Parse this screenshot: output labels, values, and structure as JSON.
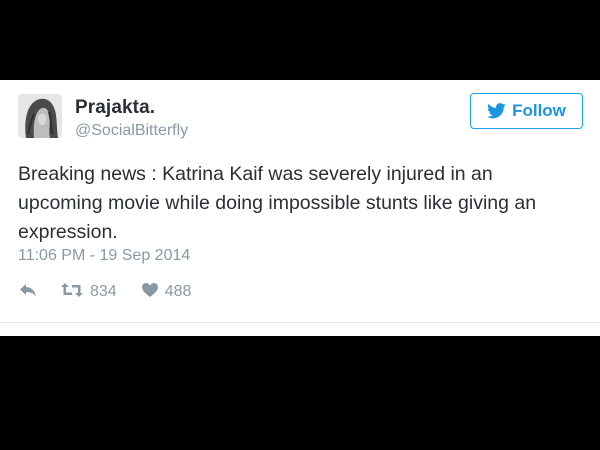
{
  "tweet": {
    "display_name": "Prajakta.",
    "handle": "@SocialBitterfly",
    "text": "Breaking news : Katrina Kaif was severely injured in an upcoming movie while doing impossible stunts like giving an expression.",
    "timestamp": "11:06 PM - 19 Sep 2014",
    "follow_label": "Follow",
    "retweet_count": "834",
    "like_count": "488"
  },
  "icons": {
    "follow": "twitter-bird-icon",
    "reply": "reply-icon",
    "retweet": "retweet-icon",
    "like": "heart-icon"
  },
  "colors": {
    "accent": "#1da1f2",
    "text": "#292f33",
    "muted": "#8899a6",
    "background": "#ffffff",
    "letterbox": "#000000"
  }
}
